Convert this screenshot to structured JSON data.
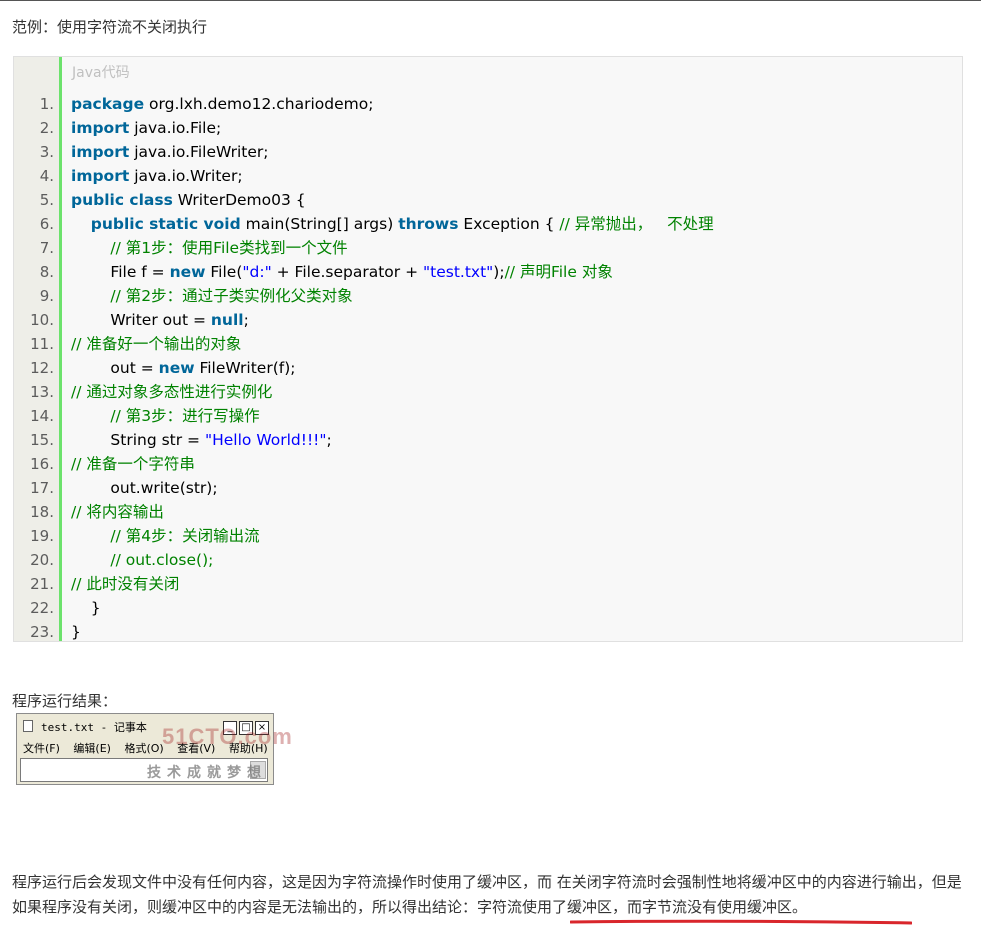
{
  "intro": "范例：使用字符流不关闭执行",
  "code": {
    "header": "Java代码",
    "lines": [
      {
        "n": "1.",
        "parts": [
          [
            "kw",
            "package"
          ],
          [
            "t",
            " org.lxh.demo12.chariodemo;"
          ]
        ]
      },
      {
        "n": "2.",
        "parts": [
          [
            "kw",
            "import"
          ],
          [
            "t",
            " java.io.File;"
          ]
        ]
      },
      {
        "n": "3.",
        "parts": [
          [
            "kw",
            "import"
          ],
          [
            "t",
            " java.io.FileWriter;"
          ]
        ]
      },
      {
        "n": "4.",
        "parts": [
          [
            "kw",
            "import"
          ],
          [
            "t",
            " java.io.Writer;"
          ]
        ]
      },
      {
        "n": "5.",
        "parts": [
          [
            "kw",
            "public class"
          ],
          [
            "t",
            " WriterDemo03 {"
          ]
        ]
      },
      {
        "n": "6.",
        "parts": [
          [
            "t",
            "    "
          ],
          [
            "kw",
            "public static void"
          ],
          [
            "t",
            " main(String[] args) "
          ],
          [
            "kw",
            "throws"
          ],
          [
            "t",
            " Exception { "
          ],
          [
            "cm",
            "// 异常抛出，   不处理"
          ]
        ]
      },
      {
        "n": "7.",
        "parts": [
          [
            "t",
            "        "
          ],
          [
            "cm",
            "// 第1步：使用File类找到一个文件"
          ]
        ]
      },
      {
        "n": "8.",
        "parts": [
          [
            "t",
            "        File f = "
          ],
          [
            "kw",
            "new"
          ],
          [
            "t",
            " File("
          ],
          [
            "str",
            "\"d:\""
          ],
          [
            "t",
            " + File.separator + "
          ],
          [
            "str",
            "\"test.txt\""
          ],
          [
            "t",
            ");"
          ],
          [
            "cm",
            "// 声明File 对象"
          ]
        ]
      },
      {
        "n": "9.",
        "parts": [
          [
            "t",
            "        "
          ],
          [
            "cm",
            "// 第2步：通过子类实例化父类对象"
          ]
        ]
      },
      {
        "n": "10.",
        "parts": [
          [
            "t",
            "        Writer out = "
          ],
          [
            "kw",
            "null"
          ],
          [
            "t",
            ";"
          ]
        ]
      },
      {
        "n": "11.",
        "parts": [
          [
            "cm",
            "// 准备好一个输出的对象"
          ]
        ]
      },
      {
        "n": "12.",
        "parts": [
          [
            "t",
            "        out = "
          ],
          [
            "kw",
            "new"
          ],
          [
            "t",
            " FileWriter(f);"
          ]
        ]
      },
      {
        "n": "13.",
        "parts": [
          [
            "cm",
            "// 通过对象多态性进行实例化"
          ]
        ]
      },
      {
        "n": "14.",
        "parts": [
          [
            "t",
            "        "
          ],
          [
            "cm",
            "// 第3步：进行写操作"
          ]
        ]
      },
      {
        "n": "15.",
        "parts": [
          [
            "t",
            "        String str = "
          ],
          [
            "str",
            "\"Hello World!!!\""
          ],
          [
            "t",
            ";"
          ]
        ]
      },
      {
        "n": "16.",
        "parts": [
          [
            "cm",
            "// 准备一个字符串"
          ]
        ]
      },
      {
        "n": "17.",
        "parts": [
          [
            "t",
            "        out.write(str);"
          ]
        ]
      },
      {
        "n": "18.",
        "parts": [
          [
            "cm",
            "// 将内容输出"
          ]
        ]
      },
      {
        "n": "19.",
        "parts": [
          [
            "t",
            "        "
          ],
          [
            "cm",
            "// 第4步：关闭输出流"
          ]
        ]
      },
      {
        "n": "20.",
        "parts": [
          [
            "t",
            "        "
          ],
          [
            "cm",
            "// out.close();"
          ]
        ]
      },
      {
        "n": "21.",
        "parts": [
          [
            "cm",
            "// 此时没有关闭"
          ]
        ]
      },
      {
        "n": "22.",
        "parts": [
          [
            "t",
            "    }"
          ]
        ]
      },
      {
        "n": "23.",
        "parts": [
          [
            "t",
            "}"
          ]
        ]
      }
    ]
  },
  "result_label": "程序运行结果：",
  "notepad": {
    "title": "test.txt - 记事本",
    "min": "_",
    "max": "□",
    "close": "×",
    "menu": [
      "文件(F)",
      "编辑(E)",
      "格式(O)",
      "查看(V)",
      "帮助(H)"
    ],
    "watermark_brand": "51CTO.com",
    "watermark_tagline": "技术成就梦想"
  },
  "conclusion": {
    "text": "程序运行后会发现文件中没有任何内容，这是因为字符流操作时使用了缓冲区，而   在关闭字符流时会强制性地将缓冲区中的内容进行输出，但是如果程序没有关闭，则缓冲区中的内容是无法输出的，所以得出结论：",
    "highlight": "字符流使用了缓冲区，而字节流没有使用缓冲区。"
  },
  "colors": {
    "gutter_border": "#6ce26c",
    "keyword": "#006699",
    "comment": "#008200",
    "string": "#0000ff",
    "underline": "#d9262c"
  }
}
